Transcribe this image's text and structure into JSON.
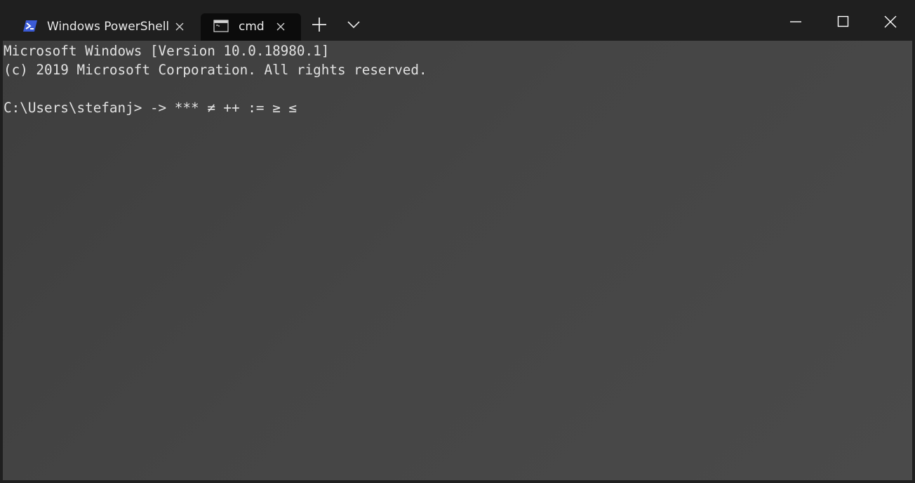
{
  "tabs": [
    {
      "label": "Windows PowerShell",
      "icon": "powershell-icon",
      "active": false
    },
    {
      "label": "cmd",
      "icon": "command-prompt-icon",
      "active": true
    }
  ],
  "toolbar": {
    "new_tab_icon": "plus-icon",
    "dropdown_icon": "chevron-down-icon"
  },
  "window_controls": {
    "minimize_icon": "minimize-icon",
    "maximize_icon": "maximize-icon",
    "close_icon": "close-icon"
  },
  "terminal": {
    "lines": [
      "Microsoft Windows [Version 10.0.18980.1]",
      "(c) 2019 Microsoft Corporation. All rights reserved.",
      "C:\\Users\\stefanj> -> *** ≠ ++ := ≥ ≤"
    ]
  },
  "colors": {
    "titlebar_background": "#1f1f1f",
    "active_tab_background": "#0c0c0c",
    "terminal_background": "#454545",
    "terminal_foreground": "#e1e1e1",
    "powershell_icon": "#3b5bd6"
  }
}
